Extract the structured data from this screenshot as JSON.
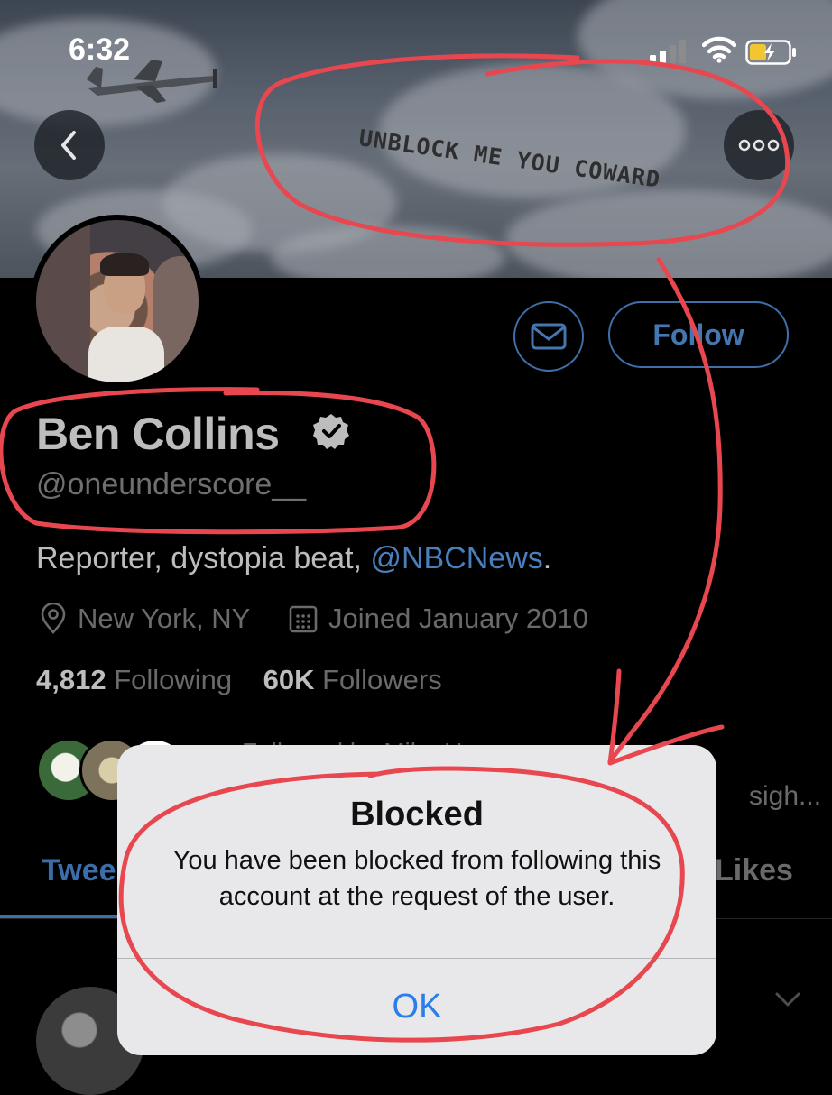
{
  "status_bar": {
    "time": "6:32",
    "signal_icon": "cellular-signal-icon",
    "wifi_icon": "wifi-icon",
    "battery_icon": "battery-charging-icon"
  },
  "banner": {
    "sky_banner_text": "UNBLOCK ME YOU COWARD"
  },
  "nav": {
    "back_icon": "chevron-left-icon",
    "more_icon": "more-dots-icon"
  },
  "profile": {
    "name": "Ben Collins",
    "handle": "@oneunderscore__",
    "bio_text": "Reporter, dystopia beat, ",
    "bio_mention": "@NBCNews",
    "bio_end": ".",
    "location": "New York, NY",
    "joined": "Joined January 2010",
    "following_count": "4,812",
    "following_label": " Following",
    "followers_count": "60K",
    "followers_label": " Followers",
    "followed_by_text": "Followed by Mike Hess,",
    "followed_by_tail": "sigh..."
  },
  "actions": {
    "message_icon": "envelope-icon",
    "follow_label": "Follow"
  },
  "tabs": {
    "tweets_partial": "Twee",
    "likes_partial": "Likes"
  },
  "alert": {
    "title": "Blocked",
    "message": "You have been blocked from following this account at the request of the user.",
    "ok_label": "OK"
  },
  "colors": {
    "accent": "#3b6ea8",
    "alert_button": "#2b7de9",
    "annotation_red": "#e8474f"
  }
}
